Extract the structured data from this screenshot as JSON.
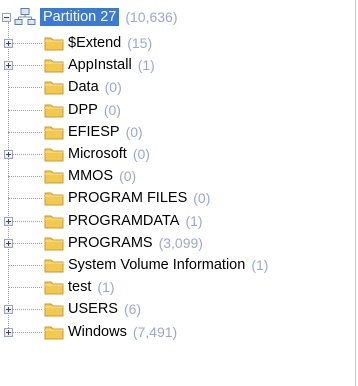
{
  "root": {
    "label": "Partition 27",
    "count": "(10,636)",
    "expanded": true,
    "icon": "network-drive-icon"
  },
  "items": [
    {
      "label": "$Extend",
      "count": "(15)",
      "expandable": true
    },
    {
      "label": "AppInstall",
      "count": "(1)",
      "expandable": true
    },
    {
      "label": "Data",
      "count": "(0)",
      "expandable": false
    },
    {
      "label": "DPP",
      "count": "(0)",
      "expandable": false
    },
    {
      "label": "EFIESP",
      "count": "(0)",
      "expandable": false
    },
    {
      "label": "Microsoft",
      "count": "(0)",
      "expandable": true
    },
    {
      "label": "MMOS",
      "count": "(0)",
      "expandable": false
    },
    {
      "label": "PROGRAM FILES",
      "count": "(0)",
      "expandable": false
    },
    {
      "label": "PROGRAMDATA",
      "count": "(1)",
      "expandable": true
    },
    {
      "label": "PROGRAMS",
      "count": "(3,099)",
      "expandable": true
    },
    {
      "label": "System Volume Information",
      "count": "(1)",
      "expandable": false
    },
    {
      "label": "test",
      "count": "(1)",
      "expandable": false
    },
    {
      "label": "USERS",
      "count": "(6)",
      "expandable": true
    },
    {
      "label": "Windows",
      "count": "(7,491)",
      "expandable": true
    }
  ],
  "colors": {
    "selection": "#3a79d6",
    "count": "#9aa7d6",
    "folder": "#f2c94c"
  }
}
